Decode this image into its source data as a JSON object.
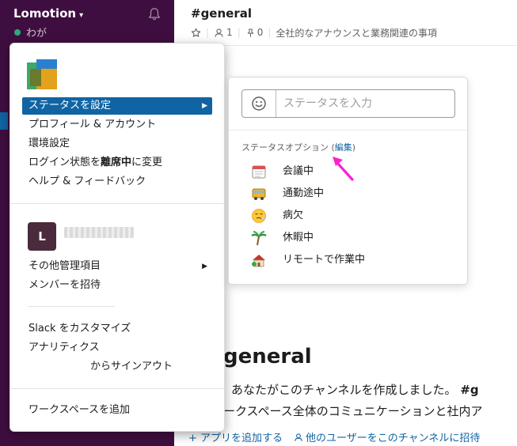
{
  "sidebar": {
    "workspace_name": "Lomotion",
    "user_name": "わが"
  },
  "channel": {
    "title": "#general",
    "member_count": "1",
    "pin_count": "0",
    "topic": "全社的なアナウンスと業務関連の事項"
  },
  "intro": {
    "title": "general",
    "line1_prefix": "あなたがこのチャンネルを作成しました。",
    "line1_suffix": "#g",
    "line2": "ークスペース全体のコミュニケーションと社内ア",
    "add_app": "+ アプリを追加する",
    "invite": "他のユーザーをこのチャンネルに招待"
  },
  "menu": {
    "set_status": "ステータスを設定",
    "profile_account": "プロフィール & アカウント",
    "preferences": "環境設定",
    "login_state_prefix": "ログイン状態を",
    "login_state_bold": "離席中",
    "login_state_suffix": "に変更",
    "help_feedback": "ヘルプ & フィードバック",
    "workspace_initial": "L",
    "other_admin": "その他管理項目",
    "invite_members": "メンバーを招待",
    "customize": "Slack をカスタマイズ",
    "analytics": "アナリティクス",
    "sign_out": "からサインアウト",
    "add_workspace": "ワークスペースを追加"
  },
  "status_popup": {
    "input_placeholder": "ステータスを入力",
    "options_header": "ステータスオプション",
    "edit_link": "編集",
    "options": [
      {
        "label": "会議中",
        "icon": "calendar-icon"
      },
      {
        "label": "通勤途中",
        "icon": "bus-icon"
      },
      {
        "label": "病欠",
        "icon": "sick-face-icon"
      },
      {
        "label": "休暇中",
        "icon": "palm-tree-icon"
      },
      {
        "label": "リモートで作業中",
        "icon": "house-icon"
      }
    ]
  },
  "colors": {
    "sidebar_bg": "#3f0e40",
    "accent": "#1164a3",
    "presence": "#2bac76",
    "annotation_arrow": "#ff1fd2"
  }
}
